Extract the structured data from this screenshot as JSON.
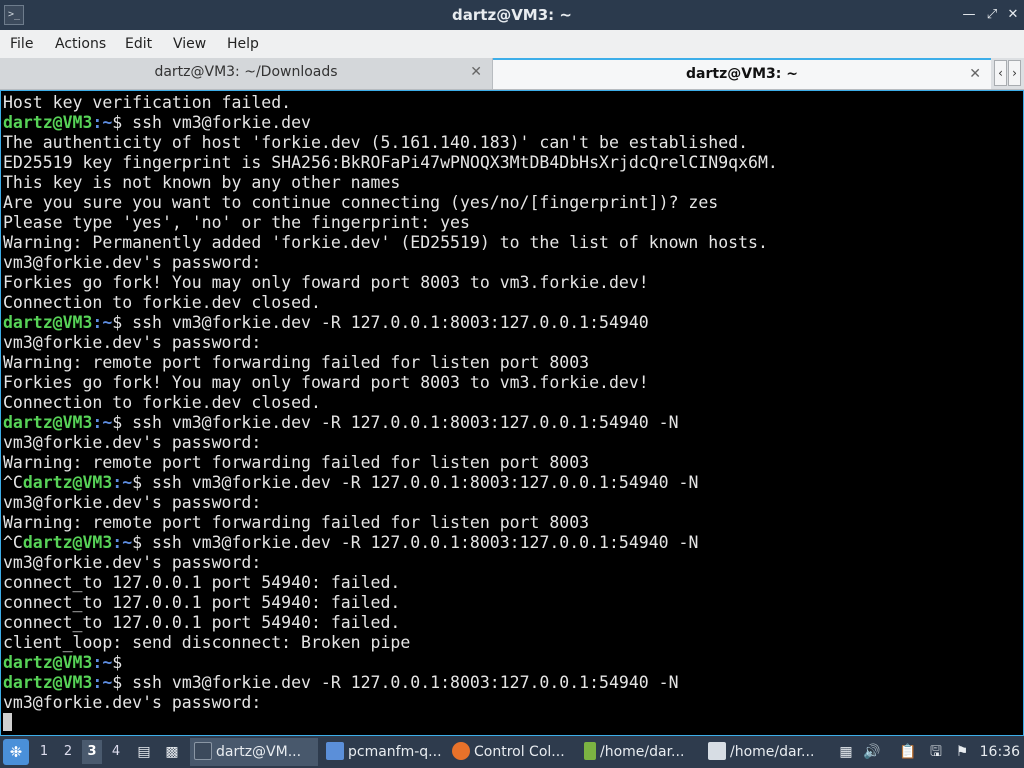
{
  "window": {
    "title": "dartz@VM3: ~",
    "app_icon": "terminal-icon",
    "controls": [
      "minimize-icon",
      "maximize-icon",
      "close-icon"
    ]
  },
  "menu": [
    "File",
    "Actions",
    "Edit",
    "View",
    "Help"
  ],
  "tabs": [
    {
      "label": "dartz@VM3: ~/Downloads",
      "active": false
    },
    {
      "label": "dartz@VM3: ~",
      "active": true
    }
  ],
  "terminal": {
    "lines": [
      {
        "out": "Host key verification failed."
      },
      {
        "prefix": "",
        "user": "dartz@VM3",
        "path": ":~",
        "cmd": "$ ssh vm3@forkie.dev"
      },
      {
        "out": "The authenticity of host 'forkie.dev (5.161.140.183)' can't be established."
      },
      {
        "out": "ED25519 key fingerprint is SHA256:BkROFaPi47wPNOQX3MtDB4DbHsXrjdcQrelCIN9qx6M."
      },
      {
        "out": "This key is not known by any other names"
      },
      {
        "out": "Are you sure you want to continue connecting (yes/no/[fingerprint])? zes"
      },
      {
        "out": "Please type 'yes', 'no' or the fingerprint: yes"
      },
      {
        "out": "Warning: Permanently added 'forkie.dev' (ED25519) to the list of known hosts."
      },
      {
        "out": "vm3@forkie.dev's password:"
      },
      {
        "out": "Forkies go fork! You may only foward port 8003 to vm3.forkie.dev!"
      },
      {
        "out": "Connection to forkie.dev closed."
      },
      {
        "prefix": "",
        "user": "dartz@VM3",
        "path": ":~",
        "cmd": "$ ssh vm3@forkie.dev -R 127.0.0.1:8003:127.0.0.1:54940"
      },
      {
        "out": "vm3@forkie.dev's password:"
      },
      {
        "out": "Warning: remote port forwarding failed for listen port 8003"
      },
      {
        "out": "Forkies go fork! You may only foward port 8003 to vm3.forkie.dev!"
      },
      {
        "out": "Connection to forkie.dev closed."
      },
      {
        "prefix": "",
        "user": "dartz@VM3",
        "path": ":~",
        "cmd": "$ ssh vm3@forkie.dev -R 127.0.0.1:8003:127.0.0.1:54940 -N"
      },
      {
        "out": "vm3@forkie.dev's password:"
      },
      {
        "out": "Warning: remote port forwarding failed for listen port 8003"
      },
      {
        "prefix": "^C",
        "user": "dartz@VM3",
        "path": ":~",
        "cmd": "$ ssh vm3@forkie.dev -R 127.0.0.1:8003:127.0.0.1:54940 -N"
      },
      {
        "out": "vm3@forkie.dev's password:"
      },
      {
        "out": "Warning: remote port forwarding failed for listen port 8003"
      },
      {
        "prefix": "^C",
        "user": "dartz@VM3",
        "path": ":~",
        "cmd": "$ ssh vm3@forkie.dev -R 127.0.0.1:8003:127.0.0.1:54940 -N"
      },
      {
        "out": "vm3@forkie.dev's password:"
      },
      {
        "out": "connect_to 127.0.0.1 port 54940: failed."
      },
      {
        "out": "connect_to 127.0.0.1 port 54940: failed."
      },
      {
        "out": "connect_to 127.0.0.1 port 54940: failed."
      },
      {
        "out": "client_loop: send disconnect: Broken pipe"
      },
      {
        "prefix": "",
        "user": "dartz@VM3",
        "path": ":~",
        "cmd": "$"
      },
      {
        "prefix": "",
        "user": "dartz@VM3",
        "path": ":~",
        "cmd": "$ ssh vm3@forkie.dev -R 127.0.0.1:8003:127.0.0.1:54940 -N"
      },
      {
        "out": "vm3@forkie.dev's password:"
      }
    ]
  },
  "taskbar": {
    "menu_icon": "app-menu-icon",
    "desktops": [
      "1",
      "2",
      "3",
      "4"
    ],
    "current_desktop": "3",
    "tasks": [
      {
        "label": "dartz@VM...",
        "icon": "terminal-icon",
        "active": true
      },
      {
        "label": "pcmanfm-q...",
        "icon": "folder-icon",
        "active": false
      },
      {
        "label": "Control Col...",
        "icon": "firefox-icon",
        "active": false
      },
      {
        "label": "/home/dar...",
        "icon": "text-editor-icon",
        "active": false
      },
      {
        "label": "/home/dar...",
        "icon": "image-viewer-icon",
        "active": false
      }
    ],
    "clock": "16:36"
  },
  "colors": {
    "accent": "#3daee9",
    "prompt_user": "#57d357",
    "prompt_path": "#5e8de0",
    "titlebar": "#2b3a4d",
    "taskbar": "#2e3b4d"
  }
}
